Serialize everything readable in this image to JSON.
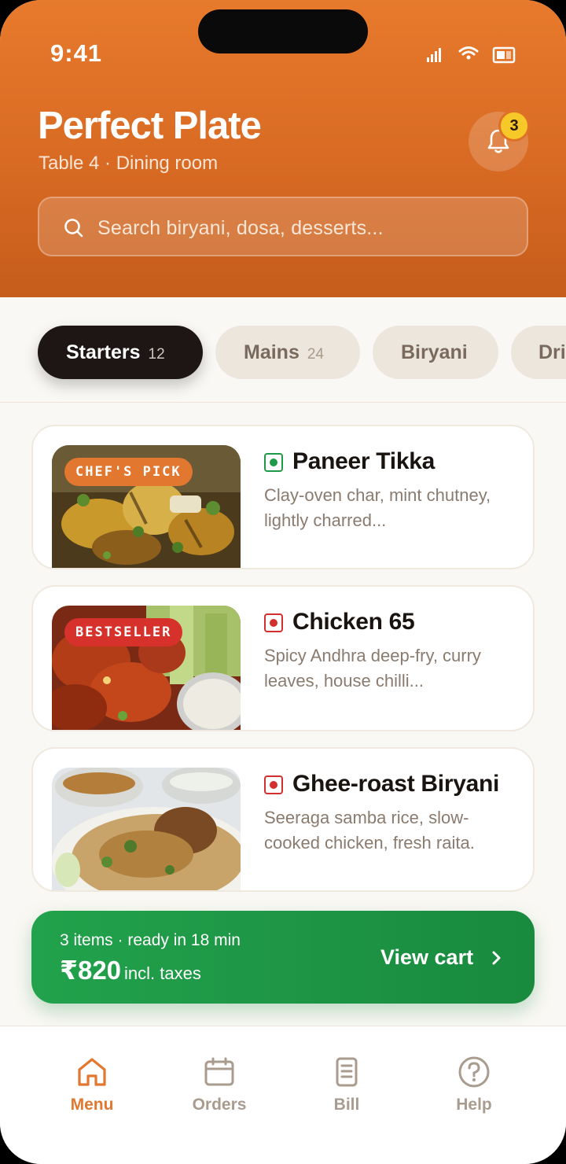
{
  "status_bar": {
    "time": "9:41"
  },
  "header": {
    "title": "Perfect Plate",
    "subtitle": "Table 4 · Dining room",
    "notifications_count": "3",
    "search_placeholder": "Search biryani, dosa, desserts..."
  },
  "categories": [
    {
      "label": "Starters",
      "count": "12",
      "active": true
    },
    {
      "label": "Mains",
      "count": "24",
      "active": false
    },
    {
      "label": "Biryani",
      "count": "",
      "active": false
    },
    {
      "label": "Dri",
      "count": "",
      "active": false
    }
  ],
  "menu_items": [
    {
      "name": "Paneer Tikka",
      "tag": "CHEF'S PICK",
      "diet": "veg",
      "description": "Clay-oven char, mint chutney, lightly charred..."
    },
    {
      "name": "Chicken 65",
      "tag": "BESTSELLER",
      "diet": "non-veg",
      "description": "Spicy Andhra deep-fry, curry leaves, house chilli..."
    },
    {
      "name": "Ghee-roast Biryani",
      "tag": "",
      "diet": "non-veg",
      "description": "Seeraga samba rice, slow-cooked chicken, fresh raita."
    }
  ],
  "cart": {
    "summary": "3 items · ready in 18 min",
    "total": "₹820",
    "total_note": "incl. taxes",
    "action_label": "View cart"
  },
  "bottom_nav": [
    {
      "label": "Menu",
      "icon": "home-icon",
      "active": true
    },
    {
      "label": "Orders",
      "icon": "calendar-icon",
      "active": false
    },
    {
      "label": "Bill",
      "icon": "receipt-icon",
      "active": false
    },
    {
      "label": "Help",
      "icon": "help-icon",
      "active": false
    }
  ],
  "colors": {
    "accent": "#e27830",
    "header_bg": "#d86a23",
    "cart_green": "#1f9a46",
    "veg_green": "#1f9a46",
    "nonveg_red": "#d32f2f",
    "badge_yellow": "#f7c928"
  }
}
